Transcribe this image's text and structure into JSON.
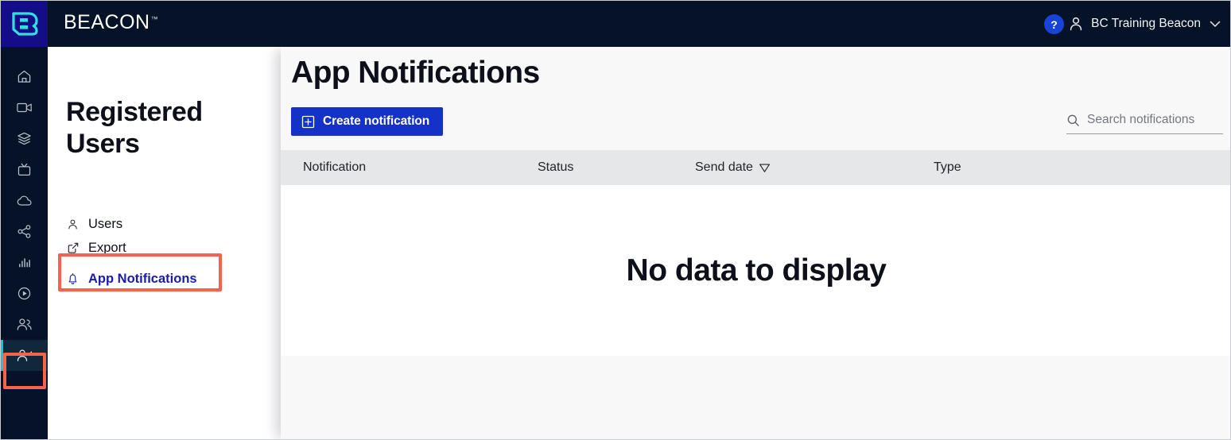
{
  "header": {
    "brand": "BEACON",
    "brand_tm": "™",
    "logo_icon": "beacon-b-logo",
    "help_label": "?",
    "account_name": "BC Training Beacon",
    "account_icon": "person-icon",
    "chevron_icon": "chevron-down-icon"
  },
  "rail": {
    "items": [
      {
        "icon": "home-icon",
        "name": "home"
      },
      {
        "icon": "video-camera-icon",
        "name": "video"
      },
      {
        "icon": "layers-icon",
        "name": "layers"
      },
      {
        "icon": "tv-icon",
        "name": "tv"
      },
      {
        "icon": "cloud-icon",
        "name": "cloud"
      },
      {
        "icon": "share-icon",
        "name": "share"
      },
      {
        "icon": "bar-chart-icon",
        "name": "analytics"
      },
      {
        "icon": "play-circle-icon",
        "name": "playback"
      },
      {
        "icon": "people-icon",
        "name": "people"
      },
      {
        "icon": "person-check-icon",
        "name": "registered-users"
      }
    ]
  },
  "subpanel": {
    "title": "Registered Users",
    "nav": [
      {
        "label": "Users",
        "icon": "person-icon"
      },
      {
        "label": "Export",
        "icon": "external-link-icon"
      },
      {
        "label": "App Notifications",
        "icon": "bell-icon"
      }
    ]
  },
  "main": {
    "title": "App Notifications",
    "create_button": "Create notification",
    "create_button_icon": "plus-square-icon",
    "search": {
      "placeholder": "Search notifications",
      "value": "",
      "icon": "search-icon"
    },
    "table": {
      "columns": [
        "Notification",
        "Status",
        "Send date",
        "Type"
      ],
      "sorted_column": "Send date",
      "sort_icon": "sort-descending-triangle-icon",
      "rows": [],
      "empty_message": "No data to display"
    }
  },
  "annotations": {
    "colors": {
      "highlight": "#f8614c",
      "accent_blue": "#1431c8",
      "link_blue": "#1b1baf",
      "teal": "#22c4c8",
      "header_navy": "#061228",
      "logo_indigo": "#140d87"
    },
    "boxes": [
      "app-notifications-nav-item",
      "registered-users-rail-icon"
    ]
  }
}
